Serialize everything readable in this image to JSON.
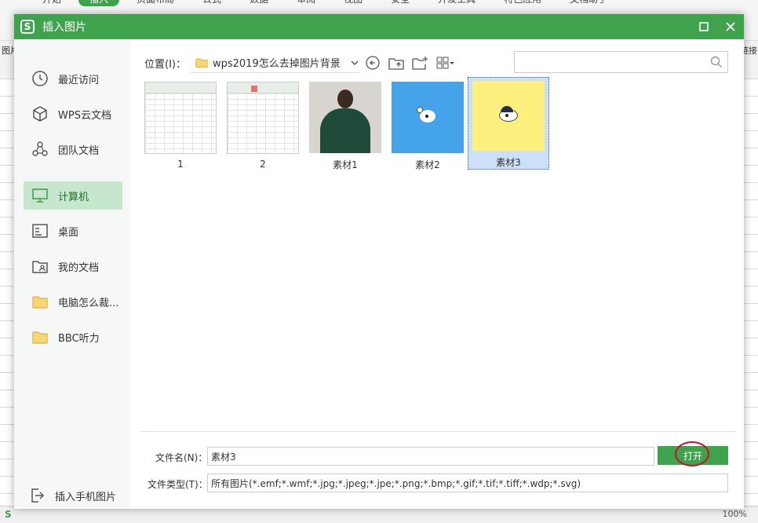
{
  "background_app": {
    "tabs": [
      "开始",
      "插入",
      "页面布局",
      "公式",
      "数据",
      "审阅",
      "视图",
      "安全",
      "开发工具",
      "特色应用",
      "文档助手"
    ],
    "active_tab": "插入",
    "left_label": "图片",
    "right_label": "链接",
    "status_left": "S",
    "status_right": "100%"
  },
  "dialog": {
    "title": "插入图片",
    "logo": "S",
    "maximize_icon": "maximize-icon",
    "close_icon": "close-icon"
  },
  "sidebar": {
    "items": [
      {
        "label": "最近访问",
        "icon": "clock-icon"
      },
      {
        "label": "WPS云文档",
        "icon": "cube-icon"
      },
      {
        "label": "团队文档",
        "icon": "team-icon"
      },
      {
        "label": "计算机",
        "icon": "monitor-icon",
        "active": true
      },
      {
        "label": "桌面",
        "icon": "desktop-icon"
      },
      {
        "label": "我的文档",
        "icon": "user-folder-icon"
      },
      {
        "label": "电脑怎么裁...",
        "icon": "folder-icon"
      },
      {
        "label": "BBC听力",
        "icon": "folder-icon"
      }
    ],
    "phone_label": "插入手机图片"
  },
  "toolbar": {
    "location_label": "位置(I)：",
    "path": "wps2019怎么去掉图片背景",
    "search_placeholder": ""
  },
  "files": [
    {
      "label": "1",
      "kind": "spreadsheet"
    },
    {
      "label": "2",
      "kind": "spreadsheet"
    },
    {
      "label": "素材1",
      "kind": "photo"
    },
    {
      "label": "素材2",
      "kind": "blue-dog"
    },
    {
      "label": "素材3",
      "kind": "yellow-dog",
      "selected": true
    }
  ],
  "form": {
    "filename_label": "文件名(N)：",
    "filename_value": "素材3",
    "filetype_label": "文件类型(T)：",
    "filetype_value": "所有图片(*.emf;*.wmf;*.jpg;*.jpeg;*.jpe;*.png;*.bmp;*.gif;*.tif;*.tiff;*.wdp;*.svg)",
    "open_label": "打开"
  },
  "colors": {
    "accent": "#3fa34d",
    "active_item_bg": "#c6e6cd",
    "selected_thumb_bg": "#cce0fa",
    "annotation_ring": "#c8102e"
  }
}
